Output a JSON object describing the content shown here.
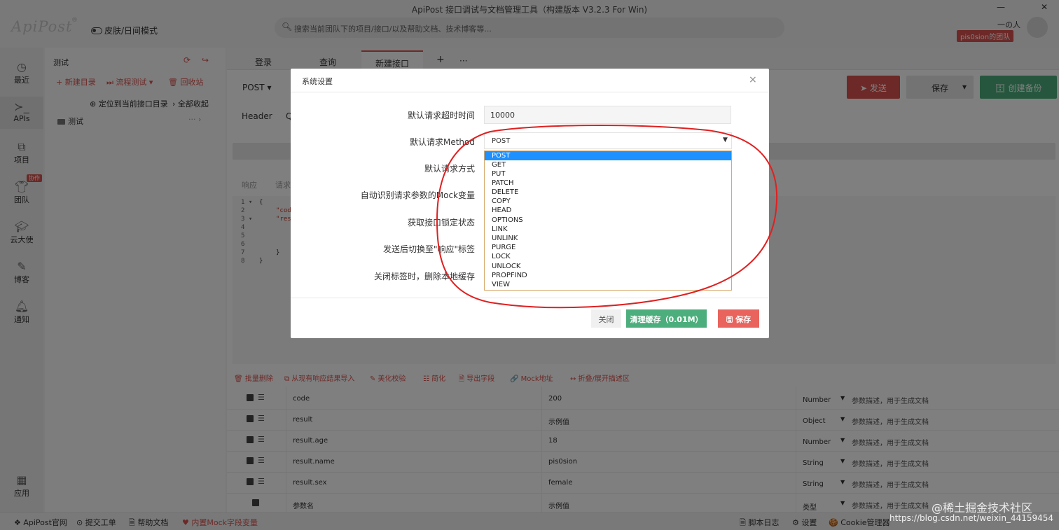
{
  "window": {
    "title": "ApiPost 接口调试与文档管理工具（构建版本 V3.2.3 For Win)",
    "minimize": "—",
    "close": "✕"
  },
  "header": {
    "logo": "ApiPost",
    "logo_mark": "®",
    "skin_toggle": "皮肤/日间模式",
    "search_placeholder": "搜索当前团队下的项目/接口/以及帮助文档、技术博客等...",
    "user_name": "一の人",
    "team_badge": "pis0sion的团队"
  },
  "sidebar": {
    "items": [
      {
        "label": "最近",
        "icon": "clock-icon"
      },
      {
        "label": "APIs",
        "icon": "terminal-icon"
      },
      {
        "label": "项目",
        "icon": "project-icon"
      },
      {
        "label": "团队",
        "icon": "team-icon"
      },
      {
        "label": "云大使",
        "icon": "graduation-icon"
      },
      {
        "label": "博客",
        "icon": "edit-icon"
      },
      {
        "label": "通知",
        "icon": "bell-icon"
      },
      {
        "label": "应用",
        "icon": "apps-icon"
      }
    ],
    "team_badge": "协作"
  },
  "tree": {
    "title": "测试",
    "actions": [
      "+ 新建目录",
      "⏭ 流程测试 ▾",
      "🗑 回收站"
    ],
    "locate": "⊕ 定位到当前接口目录",
    "collapse": "› 全部收起",
    "node": "测试",
    "node_more": "···  ›"
  },
  "main": {
    "tabs": [
      "登录",
      "查询",
      "新建接口",
      "+",
      "···"
    ],
    "method": "POST ▾",
    "send": "发送",
    "save": "保存",
    "save_caret": "▾",
    "backup": "创建备份",
    "sub_tabs": [
      "Header",
      "Q"
    ],
    "resp_tabs": [
      "响应",
      "请求"
    ],
    "code_lines": [
      "1 ▾",
      "2",
      "3 ▾",
      "4",
      "5",
      "6",
      "7",
      "8"
    ],
    "code_text": [
      "{",
      "\"cod",
      "\"res",
      "}",
      "}"
    ],
    "toolbar": [
      "🗑 批量删除",
      "⧉ 从现有响应结果导入",
      "✎ 美化校验",
      "☷ 简化",
      "🗎 导出字段",
      "🔗 Mock地址",
      "↔ 折叠/展开描述区"
    ],
    "rows": [
      {
        "name": "code",
        "value": "200",
        "type": "Number",
        "desc": "参数描述，用于生成文档"
      },
      {
        "name": "result",
        "value": "示例值",
        "type": "Object",
        "desc": "参数描述，用于生成文档"
      },
      {
        "name": "result.age",
        "value": "18",
        "type": "Number",
        "desc": "参数描述，用于生成文档"
      },
      {
        "name": "result.name",
        "value": "pis0sion",
        "type": "String",
        "desc": "参数描述，用于生成文档"
      },
      {
        "name": "result.sex",
        "value": "female",
        "type": "String",
        "desc": "参数描述，用于生成文档"
      },
      {
        "name": "参数名",
        "value": "示例值",
        "type": "类型",
        "desc": "参数描述，用于生成文档"
      }
    ]
  },
  "status": {
    "left": [
      "❖ ApiPost官网",
      "⊙ 提交工单",
      "🗎 帮助文档",
      "♥ 内置Mock字段变量"
    ],
    "right": [
      "🗎 脚本日志",
      "⚙ 设置",
      "🍪 Cookie管理器"
    ]
  },
  "dialog": {
    "title": "系统设置",
    "close": "×",
    "labels": [
      "默认请求超时时间",
      "默认请求Method",
      "默认请求方式",
      "自动识别请求参数的Mock变量",
      "获取接口锁定状态",
      "发送后切换至\"响应\"标签",
      "关闭标签时，删除本地缓存"
    ],
    "timeout_value": "10000",
    "method_value": "POST",
    "method_options": [
      "POST",
      "GET",
      "PUT",
      "PATCH",
      "DELETE",
      "COPY",
      "HEAD",
      "OPTIONS",
      "LINK",
      "UNLINK",
      "PURGE",
      "LOCK",
      "UNLOCK",
      "PROPFIND",
      "VIEW"
    ],
    "footer": {
      "close": "关闭",
      "clear_cache": "清理缓存（0.01M）",
      "save": "🖫 保存"
    }
  },
  "watermark": {
    "main": "@稀土掘金技术社区",
    "url": "https://blog.csdn.net/weixin_44159454"
  },
  "colors": {
    "accent_red": "#d9534f",
    "green": "#4cae7c",
    "selected_blue": "#1e90ff",
    "annotation_red": "#e02020"
  }
}
